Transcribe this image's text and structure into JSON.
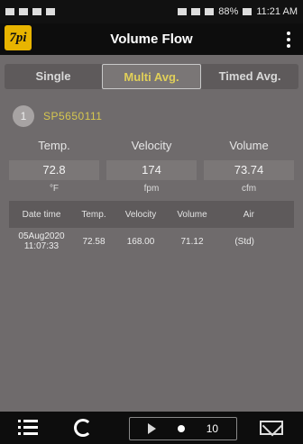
{
  "status_bar": {
    "battery": "88%",
    "time": "11:21 AM"
  },
  "app_bar": {
    "logo": "7pi",
    "title": "Volume Flow"
  },
  "tabs": [
    {
      "label": "Single",
      "active": false
    },
    {
      "label": "Multi Avg.",
      "active": true
    },
    {
      "label": "Timed Avg.",
      "active": false
    }
  ],
  "probe": {
    "badge": "1",
    "id": "SP5650111"
  },
  "readings": [
    {
      "label": "Temp.",
      "value": "72.8",
      "unit": "°F"
    },
    {
      "label": "Velocity",
      "value": "174",
      "unit": "fpm"
    },
    {
      "label": "Volume",
      "value": "73.74",
      "unit": "cfm"
    }
  ],
  "table": {
    "headers": [
      "Date time",
      "Temp.",
      "Velocity",
      "Volume",
      "Air"
    ],
    "rows": [
      {
        "date": "05Aug2020",
        "time": "11:07:33",
        "temp": "72.58",
        "velocity": "168.00",
        "volume": "71.12",
        "air": "(Std)"
      }
    ]
  },
  "bottom_bar": {
    "count": "10"
  }
}
